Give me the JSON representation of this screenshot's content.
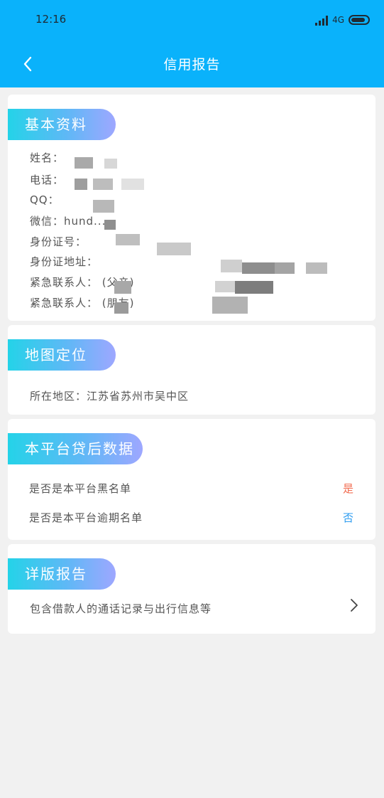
{
  "status_bar": {
    "time": "12:16",
    "network": "4G"
  },
  "header": {
    "title": "信用报告"
  },
  "basic_info": {
    "section_title": "基本资料",
    "rows": [
      "姓名：",
      "电话：",
      "QQ：",
      "微信：hund...",
      "身份证号：",
      "身份证地址：",
      "紧急联系人：           (父亲)",
      "紧急联系人：           (朋友)"
    ]
  },
  "map_location": {
    "section_title": "地图定位",
    "region": "所在地区：江苏省苏州市吴中区"
  },
  "platform_data": {
    "section_title": "本平台贷后数据",
    "rows": [
      {
        "label": "是否是本平台黑名单",
        "value": "是",
        "color": "#f26b4f"
      },
      {
        "label": "是否是本平台逾期名单",
        "value": "否",
        "color": "#2d9cf0"
      }
    ]
  },
  "detail_report": {
    "section_title": "详版报告",
    "description": "包含借款人的通话记录与出行信息等"
  }
}
